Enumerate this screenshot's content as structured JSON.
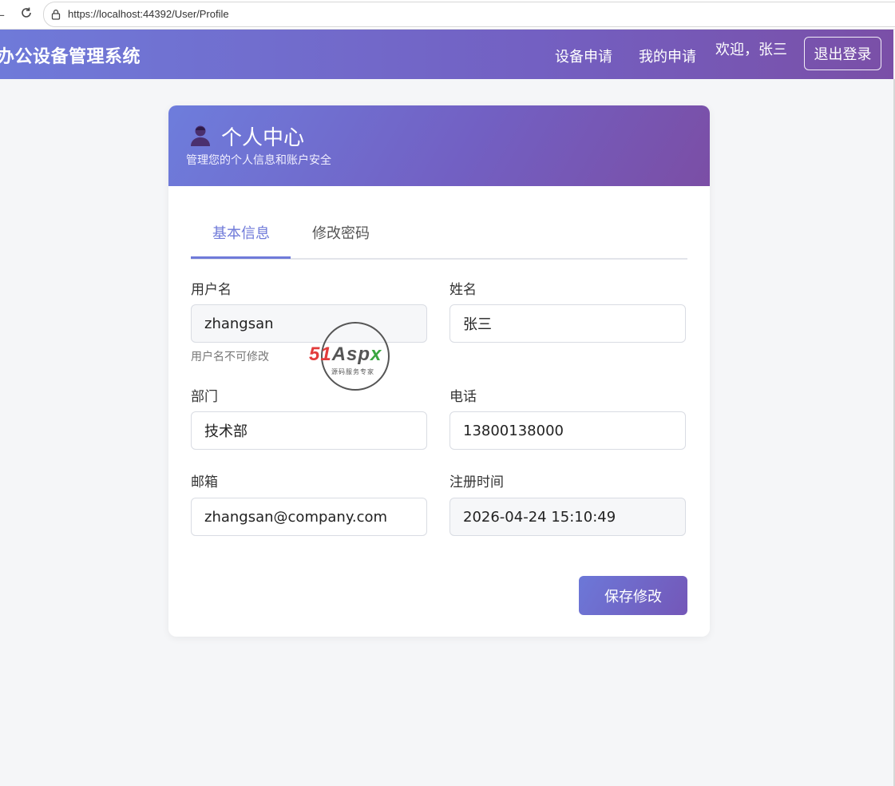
{
  "browser": {
    "url": "https://localhost:44392/User/Profile"
  },
  "navbar": {
    "brand": "办公设备管理系统",
    "links": [
      "设备申请",
      "我的申请"
    ],
    "welcome": "欢迎，张三",
    "logout_label": "退出登录",
    "gradient_start": "#6f7ad9",
    "gradient_end": "#7a4fa7"
  },
  "card": {
    "title": "个人中心",
    "subtitle": "管理您的个人信息和账户安全",
    "tabs": [
      {
        "label": "基本信息",
        "active": true
      },
      {
        "label": "修改密码",
        "active": false
      }
    ],
    "fields": {
      "username": {
        "label": "用户名",
        "value": "zhangsan",
        "hint": "用户名不可修改",
        "readonly": true
      },
      "name": {
        "label": "姓名",
        "value": "张三"
      },
      "department": {
        "label": "部门",
        "value": "技术部"
      },
      "phone": {
        "label": "电话",
        "value": "13800138000"
      },
      "email": {
        "label": "邮箱",
        "value": "zhangsan@company.com"
      },
      "registered_at": {
        "label": "注册时间",
        "value": "2026-04-24 15:10:49",
        "readonly": true
      }
    },
    "save_label": "保存修改",
    "accent_color": "#6f7ad9"
  },
  "watermark": {
    "brand_part1": "51",
    "brand_part2": "Asp",
    "brand_part3": "x",
    "tagline": "源码服务专家"
  }
}
